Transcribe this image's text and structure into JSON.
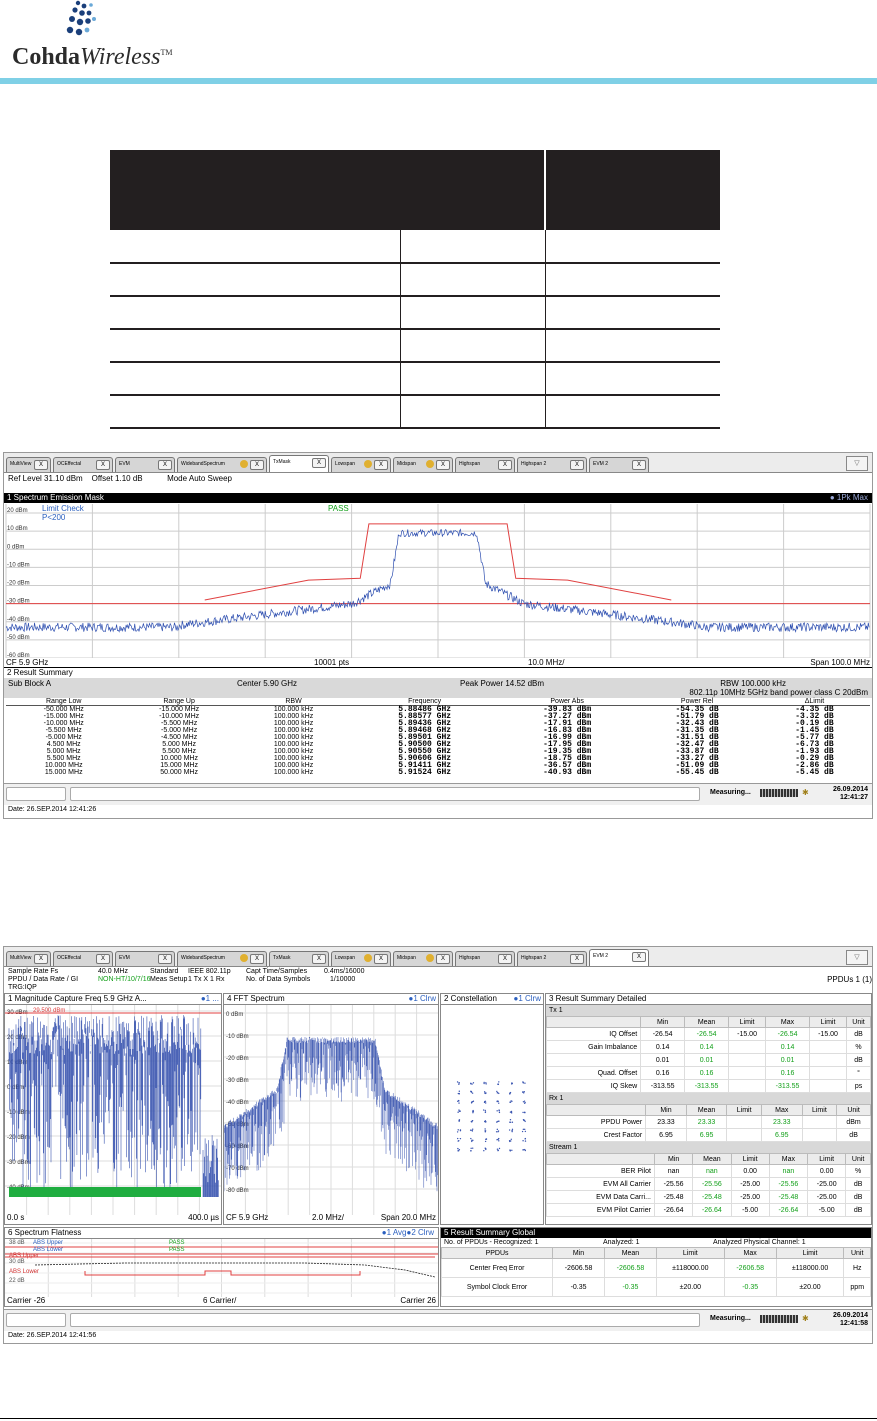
{
  "header": {
    "logo_word_bold": "Cohda",
    "logo_word_italic": "Wireless",
    "logo_tm": "TM"
  },
  "table": {
    "rows": 6,
    "columns": 3
  },
  "shot1": {
    "tabs": [
      "MultiView",
      "OCEffectal",
      "EVM",
      "WidebandSpectrum",
      "TxMask",
      "Lowspan",
      "Midspan",
      "Highspan",
      "Highspan 2",
      "EVM 2"
    ],
    "active_tab": "TxMask",
    "ref_level": "Ref Level 31.10 dBm",
    "offset": "Offset 1.10 dB",
    "mode": "Mode Auto Sweep",
    "panel1_title": "1 Spectrum Emission Mask",
    "panel1_right": "● 1Pk Max",
    "limit_check": "Limit Check",
    "limit_value": "P<200",
    "pass": "PASS",
    "y_ticks": [
      "20 dBm",
      "10 dBm",
      "0 dBm",
      "-10 dBm",
      "-20 dBm",
      "-30 dBm",
      "-40 dBm",
      "-50 dBm",
      "-60 dBm"
    ],
    "cf": "CF 5.9 GHz",
    "pts": "10001 pts",
    "div": "10.0 MHz/",
    "span": "Span 100.0 MHz",
    "panel2_title": "2 Result Summary",
    "sub_block": "Sub Block A",
    "center": "Center  5.90 GHz",
    "peak_power": "Peak Power  14.52 dBm",
    "rbw": "RBW  100.000 kHz",
    "std": "802.11p 10MHz 5GHz band power class C 20dBm",
    "columns": [
      "Range Low",
      "Range Up",
      "RBW",
      "Frequency",
      "Power Abs",
      "Power Rel",
      "ΔLimit"
    ],
    "rows": [
      [
        "-50.000 MHz",
        "-15.000 MHz",
        "100.000 kHz",
        "5.88486 GHz",
        "-39.83 dBm",
        "-54.35 dB",
        "-4.35 dB"
      ],
      [
        "-15.000 MHz",
        "-10.000 MHz",
        "100.000 kHz",
        "5.88577 GHz",
        "-37.27 dBm",
        "-51.79 dB",
        "-3.32 dB"
      ],
      [
        "-10.000 MHz",
        "-5.500 MHz",
        "100.000 kHz",
        "5.89436 GHz",
        "-17.91 dBm",
        "-32.43 dB",
        "-0.19 dB"
      ],
      [
        "-5.500 MHz",
        "-5.000 MHz",
        "100.000 kHz",
        "5.89468 GHz",
        "-16.83 dBm",
        "-31.35 dB",
        "-1.45 dB"
      ],
      [
        "-5.000 MHz",
        "-4.500 MHz",
        "100.000 kHz",
        "5.89501 GHz",
        "-16.99 dBm",
        "-31.51 dB",
        "-5.77 dB"
      ],
      [
        "4.500 MHz",
        "5.000 MHz",
        "100.000 kHz",
        "5.90500 GHz",
        "-17.95 dBm",
        "-32.47 dB",
        "-6.73 dB"
      ],
      [
        "5.000 MHz",
        "5.500 MHz",
        "100.000 kHz",
        "5.90550 GHz",
        "-19.35 dBm",
        "-33.87 dB",
        "-1.93 dB"
      ],
      [
        "5.500 MHz",
        "10.000 MHz",
        "100.000 kHz",
        "5.90606 GHz",
        "-18.75 dBm",
        "-33.27 dB",
        "-0.29 dB"
      ],
      [
        "10.000 MHz",
        "15.000 MHz",
        "100.000 kHz",
        "5.91411 GHz",
        "-36.57 dBm",
        "-51.09 dB",
        "-2.86 dB"
      ],
      [
        "15.000 MHz",
        "50.000 MHz",
        "100.000 kHz",
        "5.91524 GHz",
        "-40.93 dBm",
        "-55.45 dB",
        "-5.45 dB"
      ]
    ],
    "measuring": "Measuring...",
    "date": "26.09.2014",
    "time": "12:41:27",
    "caption": "Date: 26.SEP.2014  12:41:26"
  },
  "shot2": {
    "tabs": [
      "MultiView",
      "OCEffectal",
      "EVM",
      "WidebandSpectrum",
      "TxMask",
      "Lowspan",
      "Midspan",
      "Highspan",
      "Highspan 2",
      "EVM 2"
    ],
    "active_tab": "EVM 2",
    "sample_rate_label": "Sample Rate Fs",
    "sample_rate": "40.0 MHz",
    "standard_label": "Standard",
    "standard": "IEEE 802.11p",
    "capt_label": "Capt Time/Samples",
    "capt": "0.4ms/16000",
    "ppdu_label": "PPDU / Data Rate / GI",
    "ppdu": "NON-HT/10/7/16",
    "meas_label": "Meas Setup",
    "meas": "1 Tx X 1 Rx",
    "nsym_label": "No. of Data Symbols",
    "nsym": "1/10000",
    "trg": "TRG:IQP",
    "ppdus": "PPDUs  1 (1)",
    "p1_title": "1 Magnitude Capture  Freq 5.9 GHz A...",
    "p1_badge": "●1 ...",
    "p1_marker": "29.500 dBm",
    "p1_y": [
      "30 dBm",
      "20 dBm",
      "10 dBm",
      "0 dBm",
      "-10 dBm",
      "-20 dBm",
      "-30 dBm",
      "-40 dBm"
    ],
    "p1_x0": "0.0 s",
    "p1_x1": "400.0 µs",
    "p4_title": "4 FFT Spectrum",
    "p4_badge": "●1 Clrw",
    "p4_y": [
      "0 dBm",
      "-10 dBm",
      "-20 dBm",
      "-30 dBm",
      "-40 dBm",
      "-50 dBm",
      "-60 dBm",
      "-70 dBm",
      "-80 dBm"
    ],
    "p4_cf": "CF 5.9 GHz",
    "p4_div": "2.0 MHz/",
    "p4_span": "Span 20.0 MHz",
    "p2_title": "2 Constellation",
    "p2_badge": "●1 Clrw",
    "p3_title": "3 Result Summary Detailed",
    "cols": [
      "",
      "Min",
      "Mean",
      "Limit",
      "Max",
      "Limit",
      "Unit"
    ],
    "tx_label": "Tx 1",
    "tx_rows": [
      [
        "IQ Offset",
        "-26.54",
        "-26.54",
        "-15.00",
        "-26.54",
        "-15.00",
        "dB"
      ],
      [
        "Gain Imbalance",
        "0.14",
        "0.14",
        "",
        "0.14",
        "",
        "%"
      ],
      [
        "",
        "0.01",
        "0.01",
        "",
        "0.01",
        "",
        "dB"
      ],
      [
        "Quad. Offset",
        "0.16",
        "0.16",
        "",
        "0.16",
        "",
        "°"
      ],
      [
        "IQ Skew",
        "-313.55",
        "-313.55",
        "",
        "-313.55",
        "",
        "ps"
      ]
    ],
    "rx_label": "Rx 1",
    "rx_rows": [
      [
        "PPDU Power",
        "23.33",
        "23.33",
        "",
        "23.33",
        "",
        "dBm"
      ],
      [
        "Crest Factor",
        "6.95",
        "6.95",
        "",
        "6.95",
        "",
        "dB"
      ]
    ],
    "st_label": "Stream 1",
    "st_rows": [
      [
        "BER Pilot",
        "nan",
        "nan",
        "0.00",
        "nan",
        "0.00",
        "%"
      ],
      [
        "EVM All Carrier",
        "-25.56",
        "-25.56",
        "-25.00",
        "-25.56",
        "-25.00",
        "dB"
      ],
      [
        "EVM Data Carri...",
        "-25.48",
        "-25.48",
        "-25.00",
        "-25.48",
        "-25.00",
        "dB"
      ],
      [
        "EVM Pilot Carrier",
        "-26.64",
        "-26.64",
        "-5.00",
        "-26.64",
        "-5.00",
        "dB"
      ]
    ],
    "p6_title": "6 Spectrum Flatness",
    "p6_badge": "●1 Avg●2 Clrw",
    "p6_y1": "38 dB",
    "p6_y2": "30 dB",
    "p6_y3": "22 dB",
    "abs_upper": "ABS Upper",
    "abs_lower": "ABS Lower",
    "abs_upper2": "ABS Upper",
    "abs_lower2": "ABS Lower",
    "pass1": "PASS",
    "pass2": "PASS",
    "p6_x0": "Carrier -26",
    "p6_div": "6 Carrier/",
    "p6_x1": "Carrier 26",
    "p5_title": "5 Result Summary Global",
    "p5_info1": "No. of PPDUs - Recognized:  1",
    "p5_info2": "Analyzed:  1",
    "p5_info3": "Analyzed Physical Channel:  1",
    "g_cols": [
      "PPDUs",
      "Min",
      "Mean",
      "Limit",
      "Max",
      "Limit",
      "Unit"
    ],
    "g_rows": [
      [
        "Center Freq Error",
        "-2606.58",
        "-2606.58",
        "±118000.00",
        "-2606.58",
        "±118000.00",
        "Hz"
      ],
      [
        "Symbol Clock Error",
        "-0.35",
        "-0.35",
        "±20.00",
        "-0.35",
        "±20.00",
        "ppm"
      ]
    ],
    "measuring": "Measuring...",
    "date": "26.09.2014",
    "time": "12:41:58",
    "caption": "Date: 26.SEP.2014  12:41:56"
  },
  "chart_data": [
    {
      "type": "line",
      "title": "1 Spectrum Emission Mask",
      "xlabel": "",
      "ylabel": "",
      "x": [
        -50,
        -15,
        -10,
        -5.5,
        -5,
        -4.5,
        0,
        4.5,
        5,
        5.5,
        10,
        15,
        50
      ],
      "series": [
        {
          "name": "1Pk Max",
          "values": [
            -45,
            -38,
            -25,
            -16,
            4,
            9,
            9,
            9,
            4,
            -18,
            -27,
            -38,
            -45
          ]
        }
      ],
      "ylim": [
        -60,
        25
      ],
      "grid": true
    }
  ]
}
